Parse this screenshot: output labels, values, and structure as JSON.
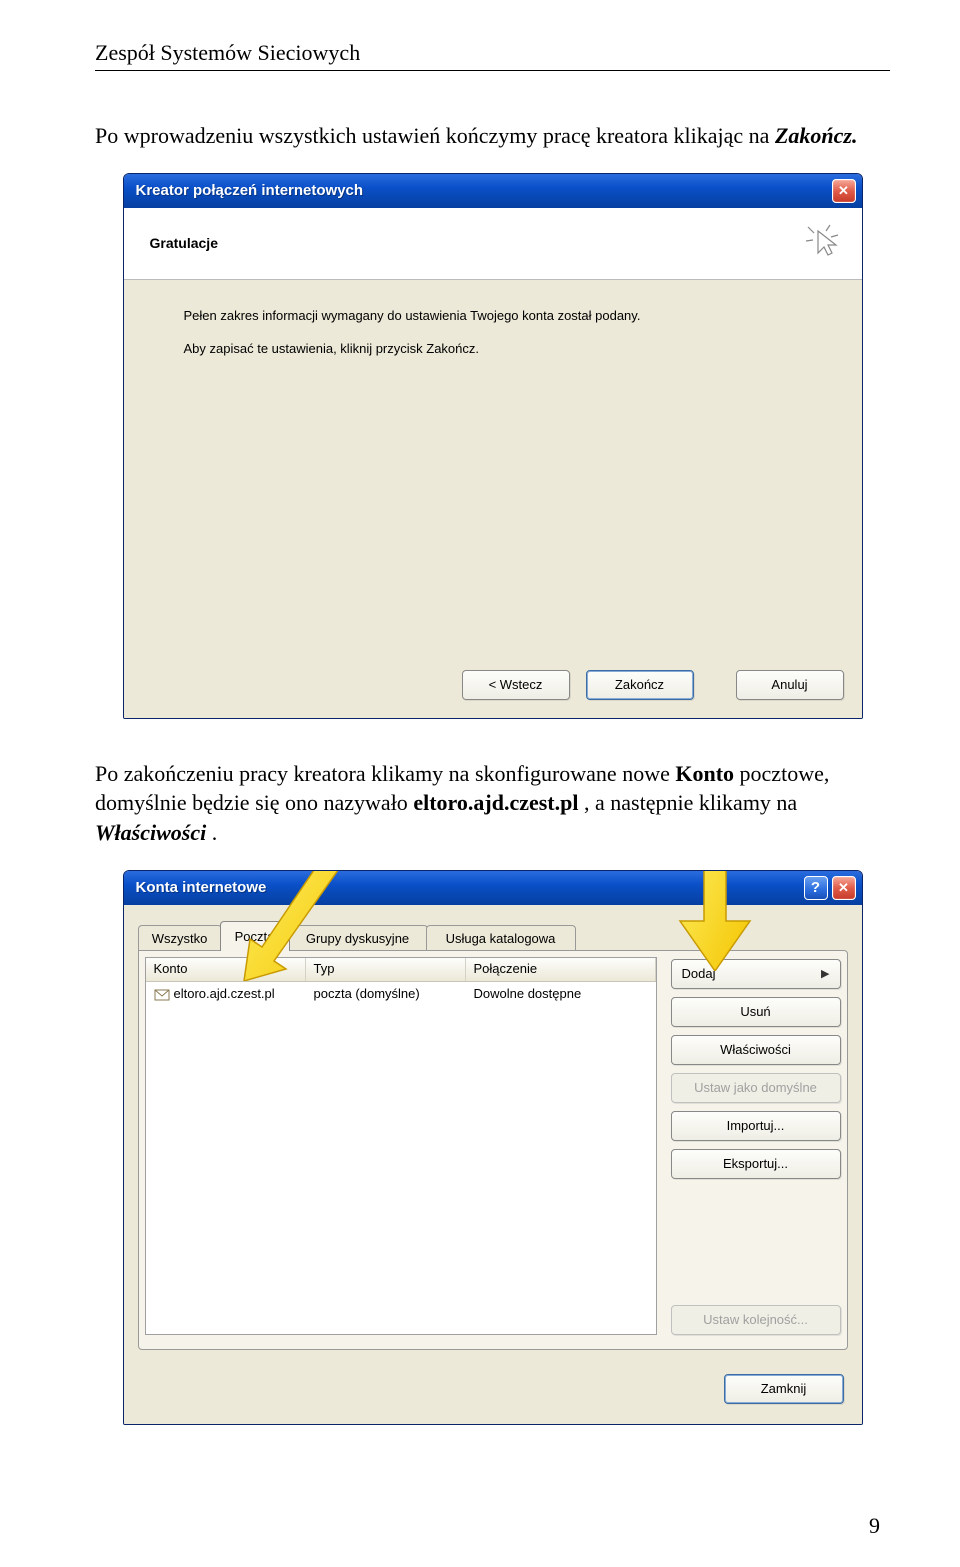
{
  "page": {
    "header": "Zespół Systemów Sieciowych",
    "page_number": "9",
    "para1_a": "Po wprowadzeniu wszystkich ustawień kończymy pracę kreatora klikając na ",
    "para1_b": "Zakończ.",
    "para2_a": "Po zakończeniu pracy kreatora klikamy na skonfigurowane nowe ",
    "para2_b": "Konto",
    "para2_c": " pocztowe, domyślnie będzie się ono nazywało ",
    "para2_d": "eltoro.ajd.czest.pl",
    "para2_e": ", a następnie klikamy na ",
    "para2_f": "Właściwości",
    "para2_g": "."
  },
  "wizard": {
    "title": "Kreator połączeń internetowych",
    "subtitle": "Gratulacje",
    "line1": "Pełen zakres informacji wymagany do ustawienia Twojego konta został podany.",
    "line2": "Aby zapisać te ustawienia, kliknij przycisk Zakończ.",
    "btn_back": "< Wstecz",
    "btn_finish": "Zakończ",
    "btn_cancel": "Anuluj"
  },
  "accounts": {
    "title": "Konta internetowe",
    "tabs": {
      "all": "Wszystko",
      "mail": "Poczta",
      "news": "Grupy dyskusyjne",
      "dir": "Usługa katalogowa"
    },
    "columns": {
      "account": "Konto",
      "type": "Typ",
      "connection": "Połączenie"
    },
    "row": {
      "account": "eltoro.ajd.czest.pl",
      "type": "poczta (domyślne)",
      "connection": "Dowolne dostępne"
    },
    "buttons": {
      "add": "Dodaj",
      "remove": "Usuń",
      "properties": "Właściwości",
      "set_default": "Ustaw jako domyślne",
      "import": "Importuj...",
      "export": "Eksportuj...",
      "set_order": "Ustaw kolejność...",
      "close": "Zamknij"
    }
  }
}
